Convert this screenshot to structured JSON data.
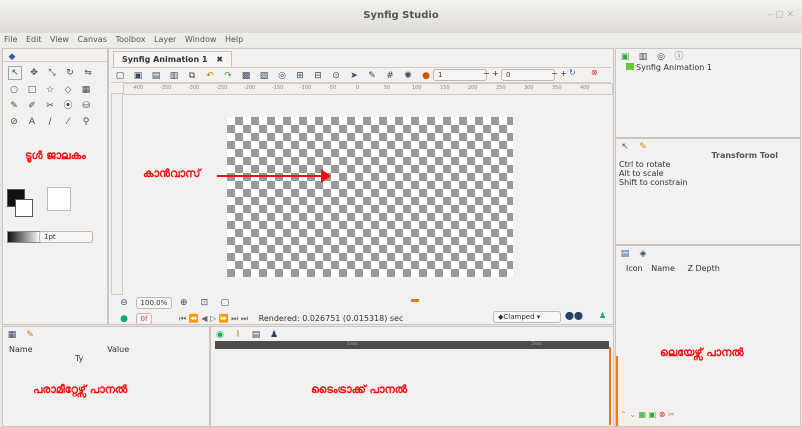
{
  "window": {
    "title": "Synfig Studio"
  },
  "menu": [
    "File",
    "Edit",
    "View",
    "Canvas",
    "Toolbox",
    "Layer",
    "Window",
    "Help"
  ],
  "canvas_tab": {
    "label": "Synfig Animation 1"
  },
  "toolbar": {
    "frame_value": "1",
    "frame_value2": "0"
  },
  "ruler_ticks": [
    "-400",
    "-350",
    "-300",
    "-250",
    "-200",
    "-150",
    "-100",
    "-50",
    "0",
    "50",
    "100",
    "150",
    "200",
    "250",
    "300",
    "350",
    "400"
  ],
  "zoom": {
    "value": "100.0%"
  },
  "status": {
    "frame_input": "0f",
    "rendered": "Rendered: 0.026751 (0.015318) sec",
    "blend": "Clamped"
  },
  "brush": {
    "size": "1pt"
  },
  "canvas_browser": {
    "item": "Synfig Animation 1"
  },
  "tool_options": {
    "title": "Transform Tool",
    "lines": [
      "Ctrl to rotate",
      "Alt to scale",
      "Shift to constrain"
    ]
  },
  "layers_panel": {
    "columns": [
      "Icon",
      "Name",
      "Z Depth"
    ]
  },
  "params_panel": {
    "columns": [
      "Name",
      "Value",
      "Ty"
    ]
  },
  "timeline": {
    "marks": [
      "1sec",
      "2sec"
    ]
  },
  "annotations": {
    "toolbox": "ടൂൾ ജാലകം",
    "canvas": "കാൻവാസ്",
    "layers": "ലെയേഴ്സ് പാനൽ",
    "params": "പരാമീറ്റേഴ്സ് പാനൽ",
    "timetrack": "ടൈംട്രാക്ക് പാനൽ"
  },
  "colors": {
    "annotation": "#e11",
    "checker_dark": "#9a9a9a"
  }
}
